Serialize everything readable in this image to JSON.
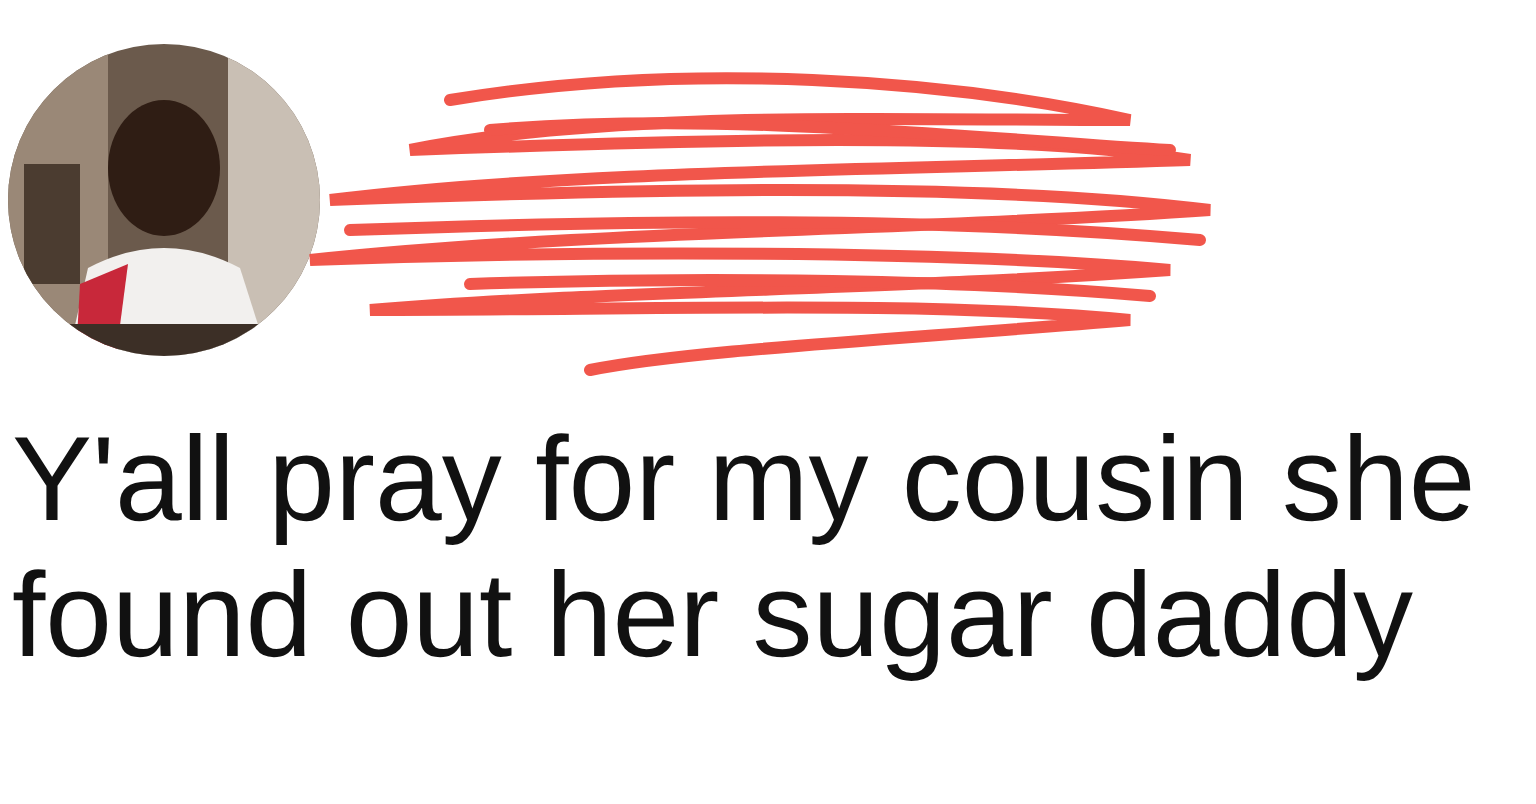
{
  "post": {
    "text_lines": [
      "Y'all pray for my cousin she",
      "found out her sugar daddy"
    ]
  }
}
